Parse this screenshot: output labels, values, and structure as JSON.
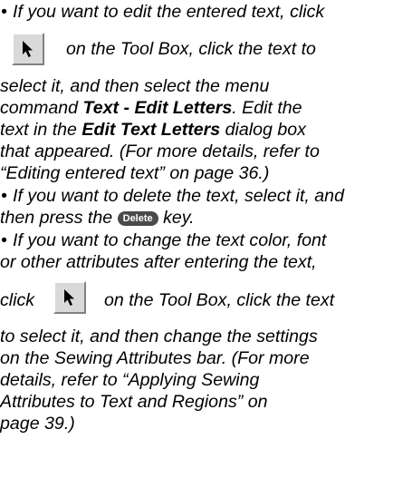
{
  "bullet_symbol": "•",
  "items": [
    {
      "lines": [
        {
          "text": "If you want to edit the entered text, click"
        },
        {
          "before": "",
          "icon": "arrow-select-tool-icon",
          "after": "on the Tool Box, click the text to"
        },
        {
          "text": "select it, and then select the menu"
        },
        {
          "pre": "command ",
          "bold": "Text - Edit Letters",
          "post": ". Edit the"
        },
        {
          "pre": "text in the ",
          "bold": "Edit Text Letters",
          "post": " dialog box"
        },
        {
          "text": "that appeared. (For more details, refer to"
        },
        {
          "text": "“Editing entered text” on page 36.)"
        }
      ]
    },
    {
      "lines": [
        {
          "text": "If you want to delete the text, select it, and"
        },
        {
          "pre": "then press the ",
          "key": "Delete",
          "post": " key."
        }
      ]
    },
    {
      "lines": [
        {
          "text": "If you want to change the text color, font"
        },
        {
          "text": "or other attributes after entering the text,"
        },
        {
          "before": "click",
          "icon": "arrow-select-tool-icon",
          "after": "on the Tool Box, click the text"
        },
        {
          "text": "to select it, and then change the settings"
        },
        {
          "text": "on the Sewing Attributes bar. (For more"
        },
        {
          "text": "details, refer to “Applying Sewing"
        },
        {
          "text": "Attributes to Text and Regions” on"
        },
        {
          "text": "page 39.)"
        }
      ]
    }
  ]
}
